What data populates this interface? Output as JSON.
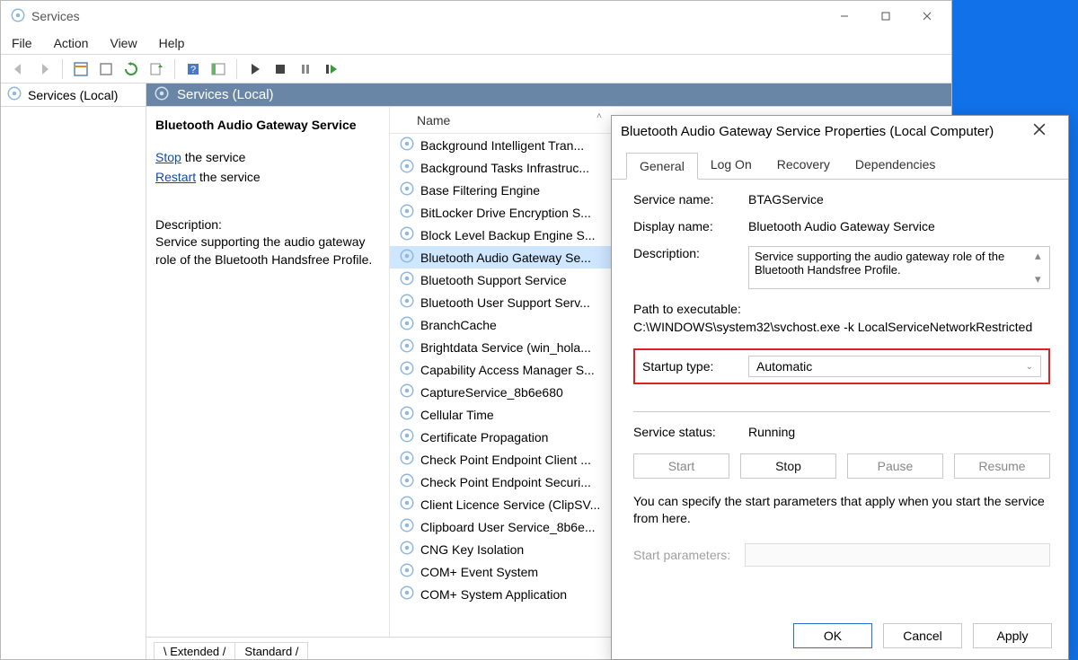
{
  "app": {
    "title": "Services"
  },
  "menus": {
    "file": "File",
    "action": "Action",
    "view": "View",
    "help": "Help"
  },
  "tree": {
    "node": "Services (Local)"
  },
  "rp_header": "Services (Local)",
  "detail": {
    "title": "Bluetooth Audio Gateway Service",
    "stop_link": "Stop",
    "stop_suffix": " the service",
    "restart_link": "Restart",
    "restart_suffix": " the service",
    "desc_label": "Description:",
    "desc": "Service supporting the audio gateway role of the Bluetooth Handsfree Profile."
  },
  "list_header": "Name",
  "services": [
    "Background Intelligent Tran...",
    "Background Tasks Infrastruc...",
    "Base Filtering Engine",
    "BitLocker Drive Encryption S...",
    "Block Level Backup Engine S...",
    "Bluetooth Audio Gateway Se...",
    "Bluetooth Support Service",
    "Bluetooth User Support Serv...",
    "BranchCache",
    "Brightdata Service (win_hola...",
    "Capability Access Manager S...",
    "CaptureService_8b6e680",
    "Cellular Time",
    "Certificate Propagation",
    "Check Point Endpoint Client ...",
    "Check Point Endpoint Securi...",
    "Client Licence Service (ClipSV...",
    "Clipboard User Service_8b6e...",
    "CNG Key Isolation",
    "COM+ Event System",
    "COM+ System Application"
  ],
  "selected_index": 5,
  "bottom_tabs": {
    "extended": "Extended",
    "standard": "Standard"
  },
  "props": {
    "title": "Bluetooth Audio Gateway Service Properties (Local Computer)",
    "tabs": {
      "general": "General",
      "logon": "Log On",
      "recovery": "Recovery",
      "dependencies": "Dependencies"
    },
    "labels": {
      "service_name": "Service name:",
      "display_name": "Display name:",
      "description": "Description:",
      "path": "Path to executable:",
      "startup_type": "Startup type:",
      "service_status": "Service status:",
      "start_parameters": "Start parameters:"
    },
    "values": {
      "service_name": "BTAGService",
      "display_name": "Bluetooth Audio Gateway Service",
      "description": "Service supporting the audio gateway role of the Bluetooth Handsfree Profile.",
      "path": "C:\\WINDOWS\\system32\\svchost.exe -k LocalServiceNetworkRestricted",
      "startup_type": "Automatic",
      "service_status": "Running"
    },
    "buttons": {
      "start": "Start",
      "stop": "Stop",
      "pause": "Pause",
      "resume": "Resume"
    },
    "hint": "You can specify the start parameters that apply when you start the service from here.",
    "dialog_buttons": {
      "ok": "OK",
      "cancel": "Cancel",
      "apply": "Apply"
    }
  }
}
